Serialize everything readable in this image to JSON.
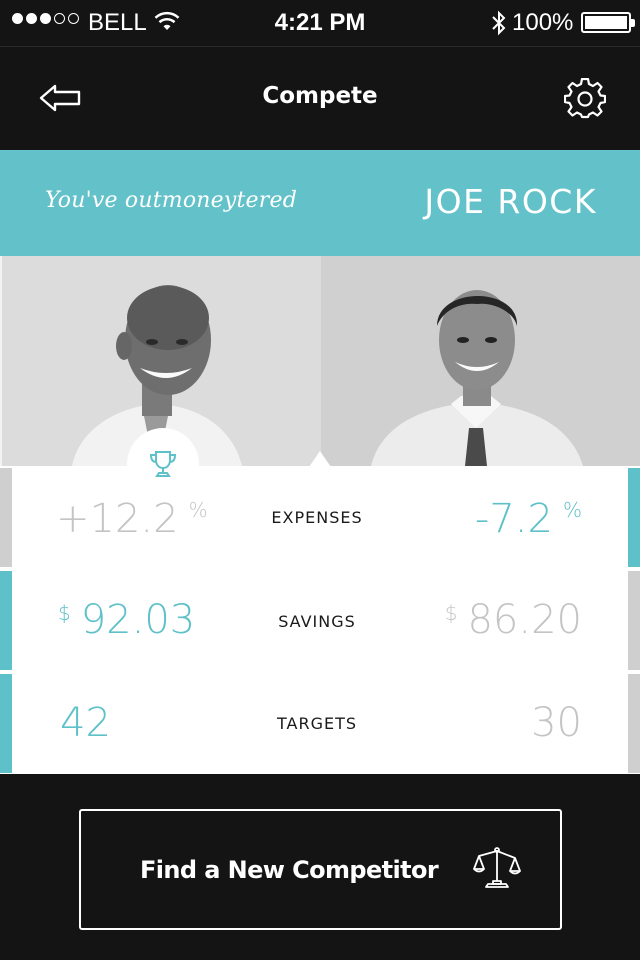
{
  "status_bar": {
    "carrier": "BELL",
    "time": "4:21 PM",
    "battery": "100%",
    "signal_bars_filled": 3,
    "signal_bars_total": 5
  },
  "nav": {
    "title": "Compete",
    "back_icon": "back-arrow-icon",
    "settings_icon": "gear-icon"
  },
  "banner": {
    "caption": "You've outmoneytered",
    "opponent_name": "JOE ROCK",
    "color": "#62c1c9"
  },
  "stats": [
    {
      "label": "EXPENSES",
      "left": {
        "prefix": "+",
        "value": "12.2",
        "unit": "%",
        "highlight": false
      },
      "right": {
        "prefix": "-",
        "value": "7.2",
        "unit": "%",
        "highlight": true
      }
    },
    {
      "label": "SAVINGS",
      "left": {
        "prefix": "$",
        "value": "92.03",
        "unit": "",
        "highlight": true
      },
      "right": {
        "prefix": "$",
        "value": "86.20",
        "unit": "",
        "highlight": false
      }
    },
    {
      "label": "TARGETS",
      "left": {
        "prefix": "",
        "value": "42",
        "unit": "",
        "highlight": true
      },
      "right": {
        "prefix": "",
        "value": "30",
        "unit": "",
        "highlight": false
      }
    }
  ],
  "cta": {
    "label": "Find a New Competitor",
    "icon": "balance-scale-icon"
  },
  "colors": {
    "accent": "#5ec0c8",
    "muted": "#c4c4c4",
    "dark": "#141414"
  }
}
